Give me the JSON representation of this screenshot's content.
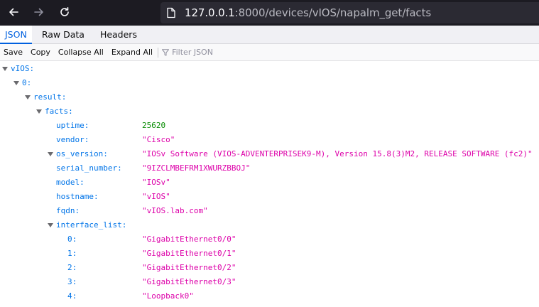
{
  "browser": {
    "url_host": "127.0.0.1",
    "url_rest": ":8000/devices/vIOS/napalm_get/facts"
  },
  "viewer": {
    "tabs": [
      "JSON",
      "Raw Data",
      "Headers"
    ],
    "toolbar": {
      "save": "Save",
      "copy": "Copy",
      "collapse_all": "Collapse All",
      "expand_all": "Expand All",
      "filter_placeholder": "Filter JSON"
    }
  },
  "tree": {
    "root_key": "vIOS:",
    "index_key": "0:",
    "result_key": "result:",
    "facts_key": "facts:",
    "facts": [
      {
        "key": "uptime:",
        "value": "25620",
        "type": "number"
      },
      {
        "key": "vendor:",
        "value": "\"Cisco\"",
        "type": "string"
      },
      {
        "key": "os_version:",
        "value": "\"IOSv Software (VIOS-ADVENTERPRISEK9-M), Version 15.8(3)M2, RELEASE SOFTWARE (fc2)\"",
        "type": "string"
      },
      {
        "key": "serial_number:",
        "value": "\"9IZCLMBEFRM1XWURZBBOJ\"",
        "type": "string"
      },
      {
        "key": "model:",
        "value": "\"IOSv\"",
        "type": "string"
      },
      {
        "key": "hostname:",
        "value": "\"vIOS\"",
        "type": "string"
      },
      {
        "key": "fqdn:",
        "value": "\"vIOS.lab.com\"",
        "type": "string"
      }
    ],
    "interface_list_key": "interface_list:",
    "interface_list": [
      {
        "key": "0:",
        "value": "\"GigabitEthernet0/0\""
      },
      {
        "key": "1:",
        "value": "\"GigabitEthernet0/1\""
      },
      {
        "key": "2:",
        "value": "\"GigabitEthernet0/2\""
      },
      {
        "key": "3:",
        "value": "\"GigabitEthernet0/3\""
      },
      {
        "key": "4:",
        "value": "\"Loopback0\""
      }
    ]
  }
}
